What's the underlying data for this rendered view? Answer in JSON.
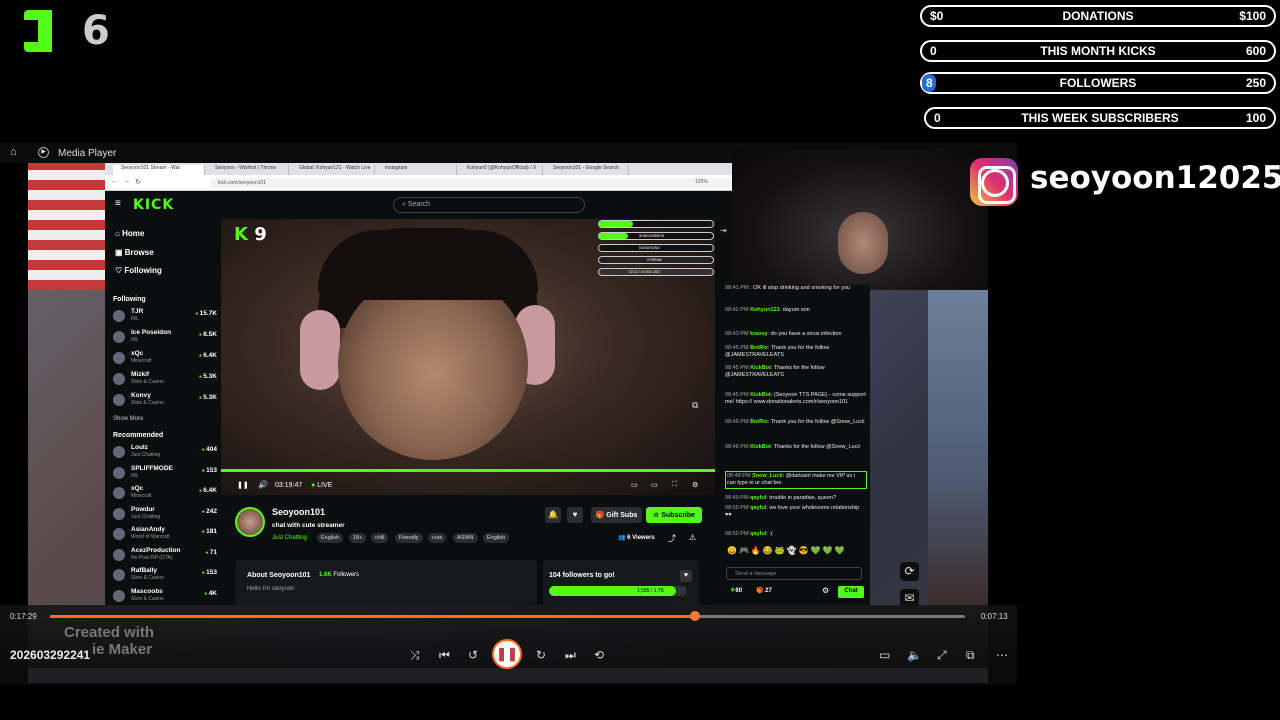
{
  "overlay": {
    "kick_count": "6",
    "goals": [
      {
        "left": "$0",
        "label": "DONATIONS",
        "right": "$100",
        "progress": 0
      },
      {
        "left": "0",
        "label": "THIS MONTH KICKS",
        "right": "600",
        "progress": 0
      },
      {
        "left": "8",
        "label": "FOLLOWERS",
        "right": "250",
        "progress": 0.032
      },
      {
        "left": "0",
        "label": "THIS WEEK SUBSCRIBERS",
        "right": "100",
        "progress": 0
      }
    ],
    "instagram_handle": "seoyoon12025"
  },
  "media_player": {
    "title": "Media Player",
    "time_elapsed": "0:17:29",
    "time_total": "0:07:13",
    "progress": 0.705,
    "file_name": "202603292241",
    "watermark_line1": "Created with",
    "watermark_line2": "ie Maker"
  },
  "browser": {
    "tabs": [
      "Seoyoon101 Stream - Wat",
      "Seoyoon - Wishlist | Throne",
      "Global: Kohyun121 - Watch Live",
      "Instagram",
      "Kohyun0 (@KohyunOfficial) / X",
      "Seoyoon101 - Google Search"
    ],
    "url": "kick.com/seoyoon101",
    "zoom": "125%"
  },
  "kick": {
    "logo": "KICK",
    "search_placeholder": "Search",
    "nav": [
      "Home",
      "Browse",
      "Following"
    ],
    "following_header": "Following",
    "following": [
      {
        "name": "TJR",
        "cat": "IRL",
        "viewers": "15.7K"
      },
      {
        "name": "Ice Poseidon",
        "cat": "IRL",
        "viewers": "8.5K"
      },
      {
        "name": "xQc",
        "cat": "Minecraft",
        "viewers": "6.4K"
      },
      {
        "name": "Mizkif",
        "cat": "Slots & Casino",
        "viewers": "5.3K"
      },
      {
        "name": "Konvy",
        "cat": "Slots & Casino",
        "viewers": "5.3K"
      }
    ],
    "show_more": "Show More",
    "recommended_header": "Recommended",
    "recommended": [
      {
        "name": "Loulz",
        "cat": "Just Chatting",
        "viewers": "404"
      },
      {
        "name": "SPLIFFMODE",
        "cat": "IRL",
        "viewers": "153"
      },
      {
        "name": "xQc",
        "cat": "Minecraft",
        "viewers": "6.4K"
      },
      {
        "name": "Powdur",
        "cat": "Just Chatting",
        "viewers": "242"
      },
      {
        "name": "AsianAndy",
        "cat": "World of Warcraft",
        "viewers": "181"
      },
      {
        "name": "AcezProduction",
        "cat": "No Pixel RP (GTA)",
        "viewers": "71"
      },
      {
        "name": "RafBally",
        "cat": "Slots & Casino",
        "viewers": "153"
      },
      {
        "name": "Mascoobs",
        "cat": "Slots & Casino",
        "viewers": "4K"
      }
    ],
    "stream_overlay_count": "9",
    "video_time": "03:19:47",
    "live_label": "LIVE",
    "streamer_name": "Seoyoon101",
    "stream_title": "chat with cute streamer",
    "category": "Just Chatting",
    "tags": [
      "English",
      "18+",
      "chill",
      "Friendly",
      "cute",
      "ASIAN",
      "English"
    ],
    "gift_label": "Gift Subs",
    "subscribe_label": "Subscribe",
    "viewers": "6 Viewers",
    "about_title": "About Seoyoon101",
    "followers_count": "1.6K",
    "followers_word": "Followers",
    "about_text": "Hello I'm seoyoon",
    "follow_goal_text": "104 followers to go!",
    "follow_goal_value": "1,585 / 1,7K",
    "follow_goal_progress": 0.92,
    "mini_goals": [
      "SUBSCRIBERS",
      "DONATIONS",
      "STREAM",
      "02.12 / 10 000 USD"
    ]
  },
  "chat": {
    "messages": [
      {
        "time": "08:41 PM",
        "user": "",
        "text": "OK ill stop drinking and smoking for you"
      },
      {
        "time": "08:42 PM",
        "user": "Kohyun121",
        "text": "dayum son"
      },
      {
        "time": "08:43 PM",
        "user": "kravvy",
        "text": "do you have a sinus infection"
      },
      {
        "time": "08:45 PM",
        "user": "BotRix",
        "text": "Thank you for the follow @JAMESTRAVELEATS"
      },
      {
        "time": "08:45 PM",
        "user": "KickBot",
        "text": "Thanks for the follow @JAMESTRAVELEATS"
      },
      {
        "time": "08:45 PM",
        "user": "KickBot",
        "text": "(Seoyoon TTS PAGE) - come support me! https:// www.donationalerts.com/r/seoyoon101"
      },
      {
        "time": "08:46 PM",
        "user": "BotRix",
        "text": "Thank you for the follow @Snow_Lucii"
      },
      {
        "time": "08:46 PM",
        "user": "KickBot",
        "text": "Thanks for the follow @Snow_Lucii"
      },
      {
        "time": "08:48 PM",
        "user": "Snow_Lucii",
        "text": "@darlusirl make me VIP so i can type in ur chat bro"
      },
      {
        "time": "08:49 PM",
        "user": "qayful",
        "text": "trouble in paradise, queen?"
      },
      {
        "time": "08:50 PM",
        "user": "qayful",
        "text": "we love your wholesome relationship ♥♥"
      },
      {
        "time": "08:50 PM",
        "user": "qayful",
        "text": ":("
      }
    ],
    "input_placeholder": "Send a message",
    "points": "60",
    "gift_count": "27",
    "send_label": "Chat"
  }
}
